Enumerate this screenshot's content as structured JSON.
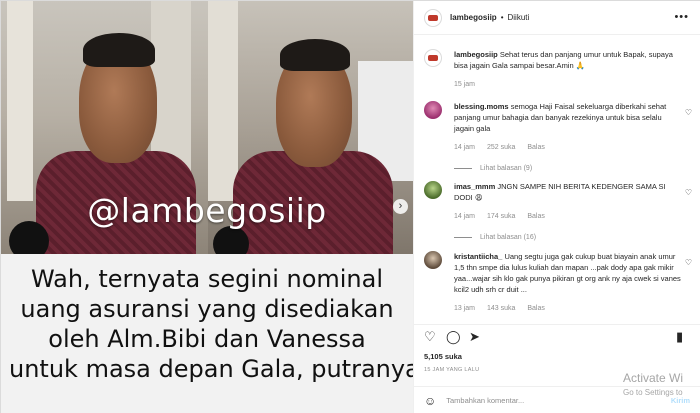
{
  "post": {
    "author": "lambegosiip",
    "separator": "•",
    "follow_status": "Diikuti",
    "watermark": "@lambegosiip",
    "caption_lines": [
      "Wah, ternyata segini nominal",
      "uang asuransi yang  disediakan",
      "oleh Alm.Bibi dan Vanessa",
      "untuk masa depan Gala, putranya"
    ],
    "likes": "5,105 suka",
    "time_ago": "15 JAM YANG LALU",
    "add_comment_placeholder": "Tambahkan komentar...",
    "post_button": "Kirim"
  },
  "comments": [
    {
      "user": "lambegosiip",
      "text": "Sehat terus dan panjang umur untuk Bapak, supaya bisa jagain Gala sampai besar.Amin 🙏",
      "time": "15 jam",
      "likes": "",
      "reply": ""
    },
    {
      "user": "blessing.moms",
      "text": "semoga Haji Faisal sekeluarga diberkahi sehat panjang umur bahagia dan banyak rezekinya untuk bisa selalu jagain gala",
      "time": "14 jam",
      "likes": "252 suka",
      "reply": "Balas",
      "view_replies": "Lihat balasan (9)"
    },
    {
      "user": "imas_mmm",
      "text": "JNGN SAMPE NIH BERITA KEDENGER SAMA SI DODI 😩",
      "time": "14 jam",
      "likes": "174 suka",
      "reply": "Balas",
      "view_replies": "Lihat balasan (16)"
    },
    {
      "user": "kristantiicha_",
      "text": "Uang segtu juga gak cukup buat biayain anak umur 1,5 thn smpe dia lulus kuliah dan mapan ...pak dody apa gak mikir yaa...wajar sih klo gak punya pikiran gt org ank ny aja cwek si vanes kcil2 udh srh cr duit ...",
      "time": "13 jam",
      "likes": "143 suka",
      "reply": "Balas"
    }
  ],
  "icons": {
    "like": "heart-icon",
    "comment": "comment-icon",
    "share": "share-icon",
    "save": "bookmark-icon",
    "more": "more-icon",
    "emoji": "smile-icon",
    "next": "chevron-right-icon"
  },
  "system": {
    "activate_title": "Activate Wi",
    "activate_sub": "Go to Settings to"
  },
  "colors": {
    "link_blue": "#b2dffc",
    "muted": "#8e8e8e",
    "text": "#262626"
  }
}
